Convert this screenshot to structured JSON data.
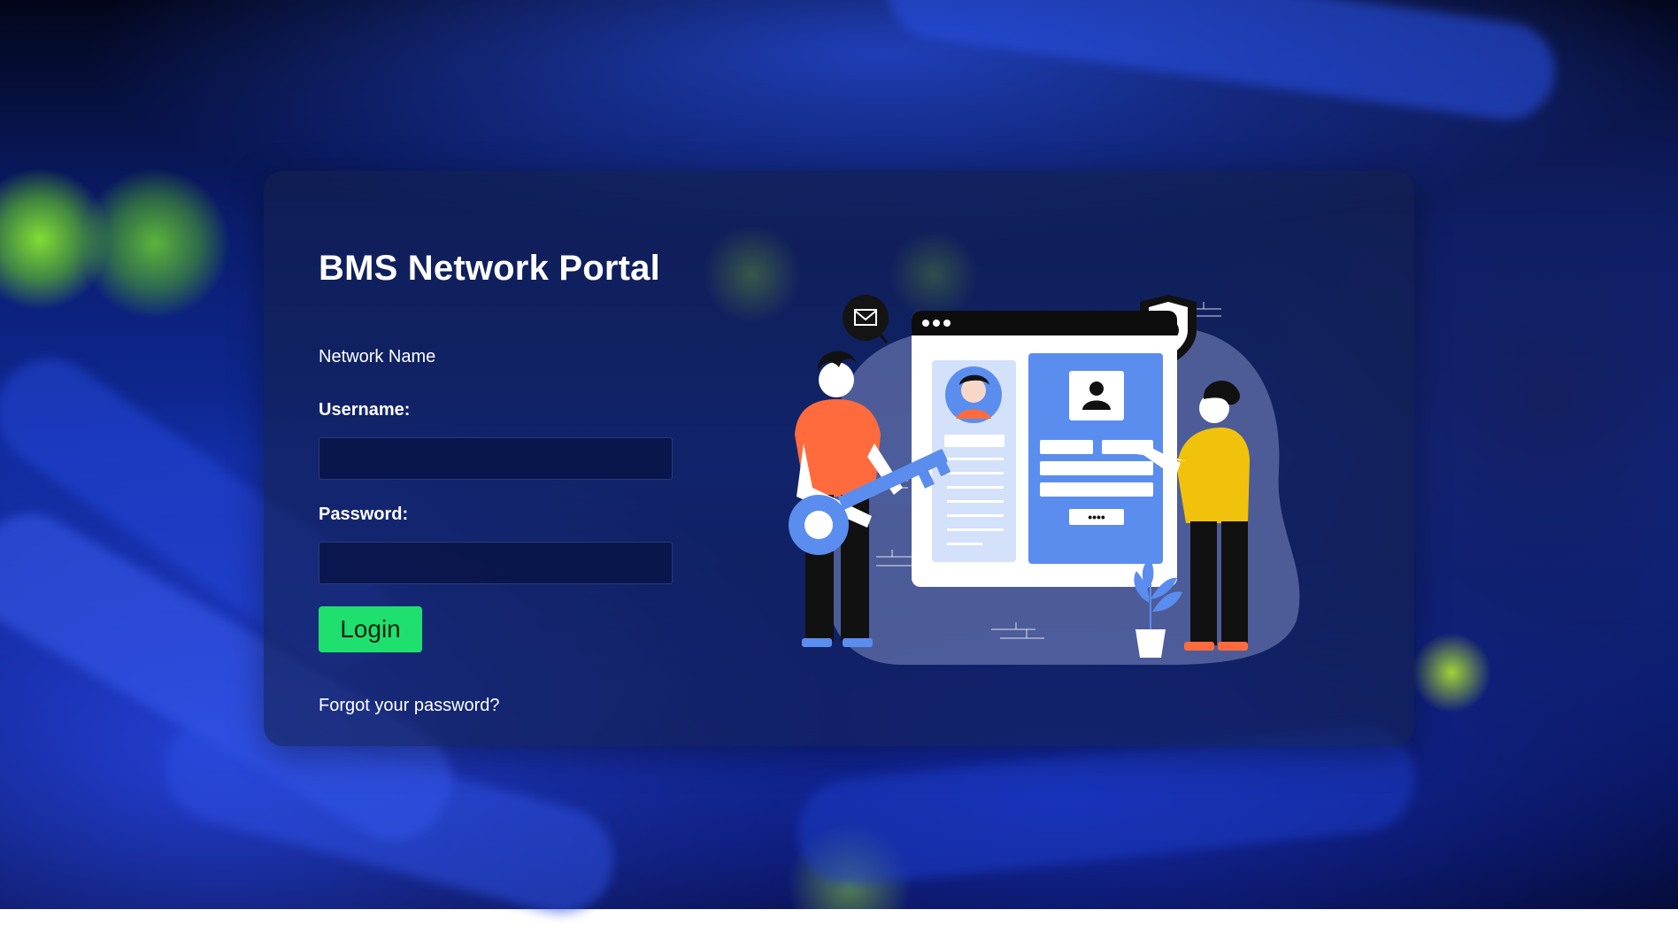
{
  "portal": {
    "title": "BMS Network Portal",
    "network_name": "Network Name",
    "username_label": "Username:",
    "username_value": "",
    "password_label": "Password:",
    "password_value": "",
    "login_label": "Login",
    "forgot_label": "Forgot your password?"
  },
  "illustration": {
    "icons": [
      "mail-icon",
      "shield-check-icon",
      "user-profile-icon",
      "key-icon",
      "plant-icon"
    ],
    "password_dots": "••••"
  },
  "colors": {
    "login_button": "#1fe06f",
    "card": "#14204e",
    "accent_blue": "#5b8def",
    "orange": "#ff6b3d",
    "yellow": "#f0c20c"
  }
}
